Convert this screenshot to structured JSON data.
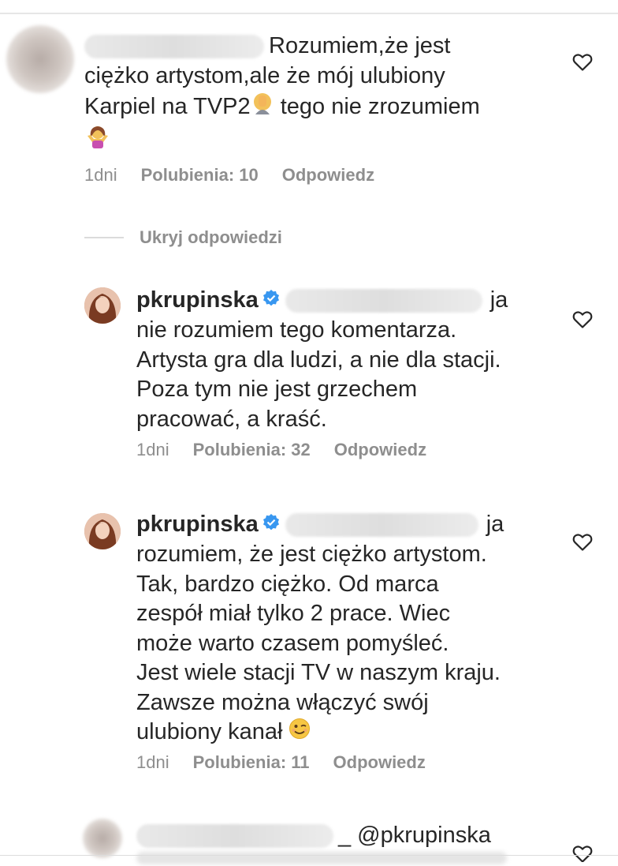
{
  "comments": [
    {
      "username": "",
      "lines": [
        "Rozumiem,że jest",
        "ciężko artystom,ale że mój ulubiony",
        "Karpiel na TVP2",
        "tego nie zrozumiem"
      ],
      "time": "1dni",
      "likes": "Polubienia: 10",
      "reply": "Odpowiedz"
    },
    {
      "username": "pkrupinska",
      "lines": [
        "ja",
        "nie rozumiem tego komentarza.",
        "Artysta gra dla ludzi, a nie dla stacji.",
        "Poza tym nie jest grzechem",
        "pracować, a kraść."
      ],
      "time": "1dni",
      "likes": "Polubienia: 32",
      "reply": "Odpowiedz"
    },
    {
      "username": "pkrupinska",
      "lines": [
        "ja",
        "rozumiem, że jest ciężko artystom.",
        "Tak, bardzo ciężko. Od marca",
        "zespół miał tylko 2 prace. Wiec",
        "może warto czasem pomyśleć.",
        "Jest wiele stacji TV w naszym kraju.",
        "Zawsze można włączyć swój",
        "ulubiony kanał"
      ],
      "time": "1dni",
      "likes": "Polubienia: 11",
      "reply": "Odpowiedz"
    },
    {
      "username": "",
      "lines": [
        "_ @pkrupinska"
      ]
    }
  ],
  "hide_replies": "Ukryj odpowiedzi",
  "icons": {
    "like": "heart-icon",
    "verified": "verified-badge-icon",
    "emoji_facepalm": "facepalm-emoji",
    "emoji_shrug": "shrug-emoji",
    "emoji_wink": "wink-emoji"
  },
  "colors": {
    "text": "#262626",
    "meta": "#8e8e8e",
    "verified": "#3897f0"
  }
}
